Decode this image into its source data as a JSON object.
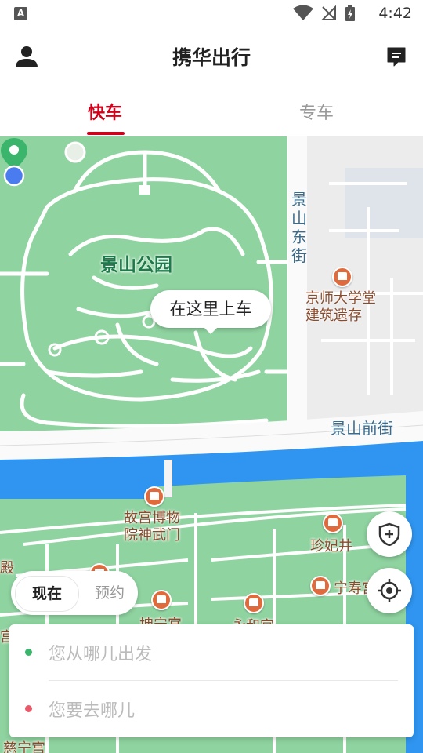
{
  "status_bar": {
    "app_badge": "A",
    "time": "4:42"
  },
  "header": {
    "title": "携华出行"
  },
  "tabs": [
    {
      "label": "快车",
      "active": true
    },
    {
      "label": "专车",
      "active": false
    }
  ],
  "colors": {
    "accent": "#d0021b",
    "park": "#8fd3a0",
    "water": "#2f95f0",
    "pickup_pin": "#3bb56b",
    "location_dot": "#4a7cf0"
  },
  "map": {
    "park_name": "景山公园",
    "street_vertical": "景山东街",
    "street_horizontal": "景山前街",
    "pois": [
      {
        "name": "京师大学堂\n建筑遗存"
      },
      {
        "name": "故宫博物\n院神武门"
      },
      {
        "name": "珍妃井"
      },
      {
        "name": "宁寿宫"
      },
      {
        "name": "坤宁宫"
      },
      {
        "name": "永和宫"
      },
      {
        "name": "慈宁宫"
      },
      {
        "name": "殿"
      },
      {
        "name": "宫"
      }
    ],
    "pickup_bubble": "在这里上车"
  },
  "buttons": {
    "safety_icon": "shield-plus-icon",
    "locate_icon": "crosshair-icon"
  },
  "time_toggle": {
    "now": "现在",
    "reserve": "预约"
  },
  "address": {
    "from_placeholder": "您从哪儿出发",
    "to_placeholder": "您要去哪儿",
    "from_dot_color": "#3bb56b",
    "to_dot_color": "#e85a6a"
  }
}
